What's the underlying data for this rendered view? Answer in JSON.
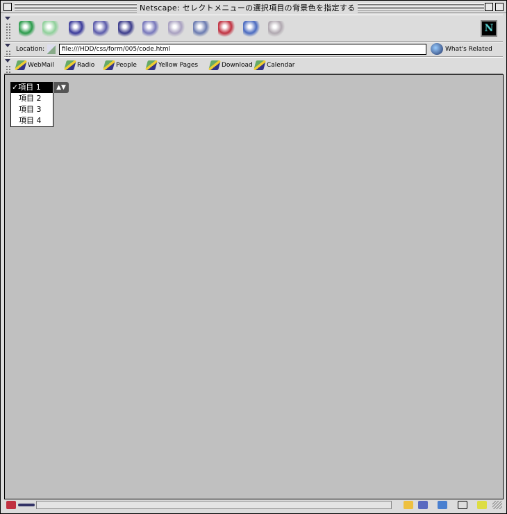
{
  "window": {
    "title": "Netscape: セレクトメニューの選択項目の背景色を指定する"
  },
  "toolbar": {
    "buttons": [
      {
        "name": "back",
        "color": "#2a9a4a"
      },
      {
        "name": "forward",
        "color": "#8fd09a"
      },
      {
        "name": "reload",
        "color": "#3a3a9a"
      },
      {
        "name": "home",
        "color": "#5a5aaa"
      },
      {
        "name": "search",
        "color": "#3a3a8a"
      },
      {
        "name": "my-netscape",
        "color": "#7777bb"
      },
      {
        "name": "images",
        "color": "#a8a0c0"
      },
      {
        "name": "print",
        "color": "#6a7ab0"
      },
      {
        "name": "security",
        "color": "#c03040"
      },
      {
        "name": "shop",
        "color": "#4a6ac0"
      },
      {
        "name": "stop",
        "color": "#b0a8b0"
      }
    ],
    "logo": "N"
  },
  "location": {
    "label": "Location:",
    "url": "file:///HDD/css/form/005/code.html",
    "related": "What's Related"
  },
  "personal": {
    "items": [
      "WebMail",
      "Radio",
      "People",
      "Yellow Pages",
      "Download",
      "Calendar"
    ]
  },
  "select": {
    "selected": "✓項目 1",
    "options": [
      "項目 2",
      "項目 3",
      "項目 4"
    ]
  }
}
